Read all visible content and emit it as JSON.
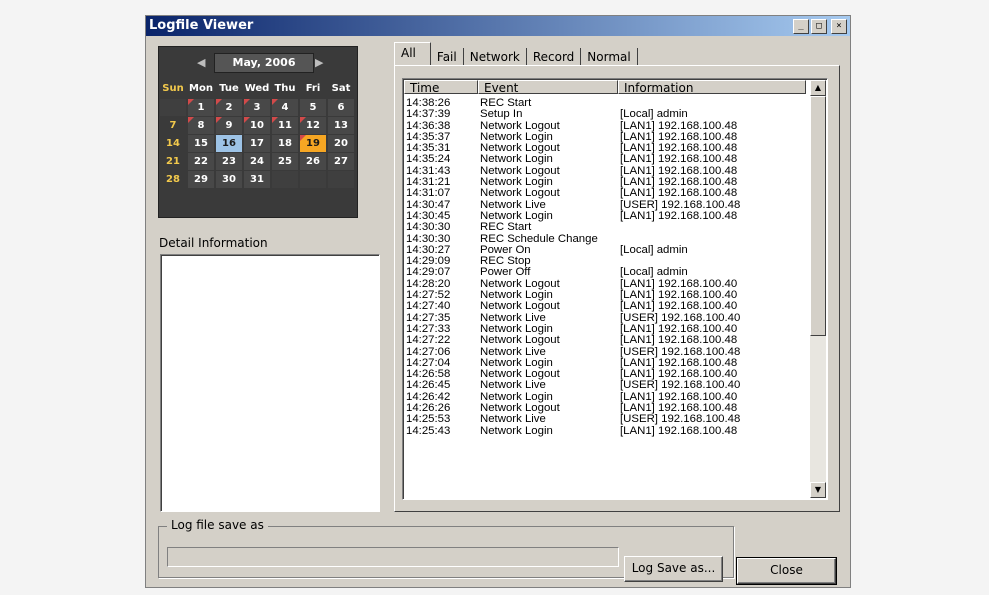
{
  "window": {
    "title": "Logfile Viewer",
    "buttons": [
      "_",
      "□",
      "×"
    ]
  },
  "calendar": {
    "month_label": "May, 2006",
    "dow": [
      "Sun",
      "Mon",
      "Tue",
      "Wed",
      "Thu",
      "Fri",
      "Sat"
    ],
    "days": [
      "",
      "1",
      "2",
      "3",
      "4",
      "5",
      "6",
      "7",
      "8",
      "9",
      "10",
      "11",
      "12",
      "13",
      "14",
      "15",
      "16",
      "17",
      "18",
      "19",
      "20",
      "21",
      "22",
      "23",
      "24",
      "25",
      "26",
      "27",
      "28",
      "29",
      "30",
      "31",
      "",
      "",
      ""
    ],
    "flagged_days": [
      "1",
      "2",
      "3",
      "4",
      "8",
      "9",
      "10",
      "11",
      "12",
      "19"
    ],
    "today": "16",
    "selected": "19"
  },
  "detail": {
    "label": "Detail Information"
  },
  "tabs": [
    "All",
    "Fail",
    "Network",
    "Record",
    "Normal"
  ],
  "log": {
    "headers": [
      "Time",
      "Event",
      "Information"
    ],
    "rows": [
      [
        "14:38:26",
        "REC Start",
        ""
      ],
      [
        "14:37:39",
        "Setup In",
        "[Local] admin"
      ],
      [
        "14:36:38",
        "Network Logout",
        "[LAN1] 192.168.100.48"
      ],
      [
        "14:35:37",
        "Network Login",
        "[LAN1] 192.168.100.48"
      ],
      [
        "14:35:31",
        "Network Logout",
        "[LAN1] 192.168.100.48"
      ],
      [
        "14:35:24",
        "Network Login",
        "[LAN1] 192.168.100.48"
      ],
      [
        "14:31:43",
        "Network Logout",
        "[LAN1] 192.168.100.48"
      ],
      [
        "14:31:21",
        "Network Login",
        "[LAN1] 192.168.100.48"
      ],
      [
        "14:31:07",
        "Network Logout",
        "[LAN1] 192.168.100.48"
      ],
      [
        "14:30:47",
        "Network Live",
        "[USER] 192.168.100.48"
      ],
      [
        "14:30:45",
        "Network Login",
        "[LAN1] 192.168.100.48"
      ],
      [
        "14:30:30",
        "REC Start",
        ""
      ],
      [
        "14:30:30",
        "REC Schedule Change",
        ""
      ],
      [
        "14:30:27",
        "Power On",
        "[Local] admin"
      ],
      [
        "14:29:09",
        "REC Stop",
        ""
      ],
      [
        "14:29:07",
        "Power Off",
        "[Local] admin"
      ],
      [
        "14:28:20",
        "Network Logout",
        "[LAN1] 192.168.100.40"
      ],
      [
        "14:27:52",
        "Network Login",
        "[LAN1] 192.168.100.40"
      ],
      [
        "14:27:40",
        "Network Logout",
        "[LAN1] 192.168.100.40"
      ],
      [
        "14:27:35",
        "Network Live",
        "[USER] 192.168.100.40"
      ],
      [
        "14:27:33",
        "Network Login",
        "[LAN1] 192.168.100.40"
      ],
      [
        "14:27:22",
        "Network Logout",
        "[LAN1] 192.168.100.48"
      ],
      [
        "14:27:06",
        "Network Live",
        "[USER] 192.168.100.48"
      ],
      [
        "14:27:04",
        "Network Login",
        "[LAN1] 192.168.100.48"
      ],
      [
        "14:26:58",
        "Network Logout",
        "[LAN1] 192.168.100.40"
      ],
      [
        "14:26:45",
        "Network Live",
        "[USER] 192.168.100.40"
      ],
      [
        "14:26:42",
        "Network Login",
        "[LAN1] 192.168.100.40"
      ],
      [
        "14:26:26",
        "Network Logout",
        "[LAN1] 192.168.100.48"
      ],
      [
        "14:25:53",
        "Network Live",
        "[USER] 192.168.100.48"
      ],
      [
        "14:25:43",
        "Network Login",
        "[LAN1] 192.168.100.48"
      ]
    ]
  },
  "save": {
    "group_label": "Log file save as",
    "path_value": "",
    "button_label": "Log Save as..."
  },
  "close_label": "Close"
}
